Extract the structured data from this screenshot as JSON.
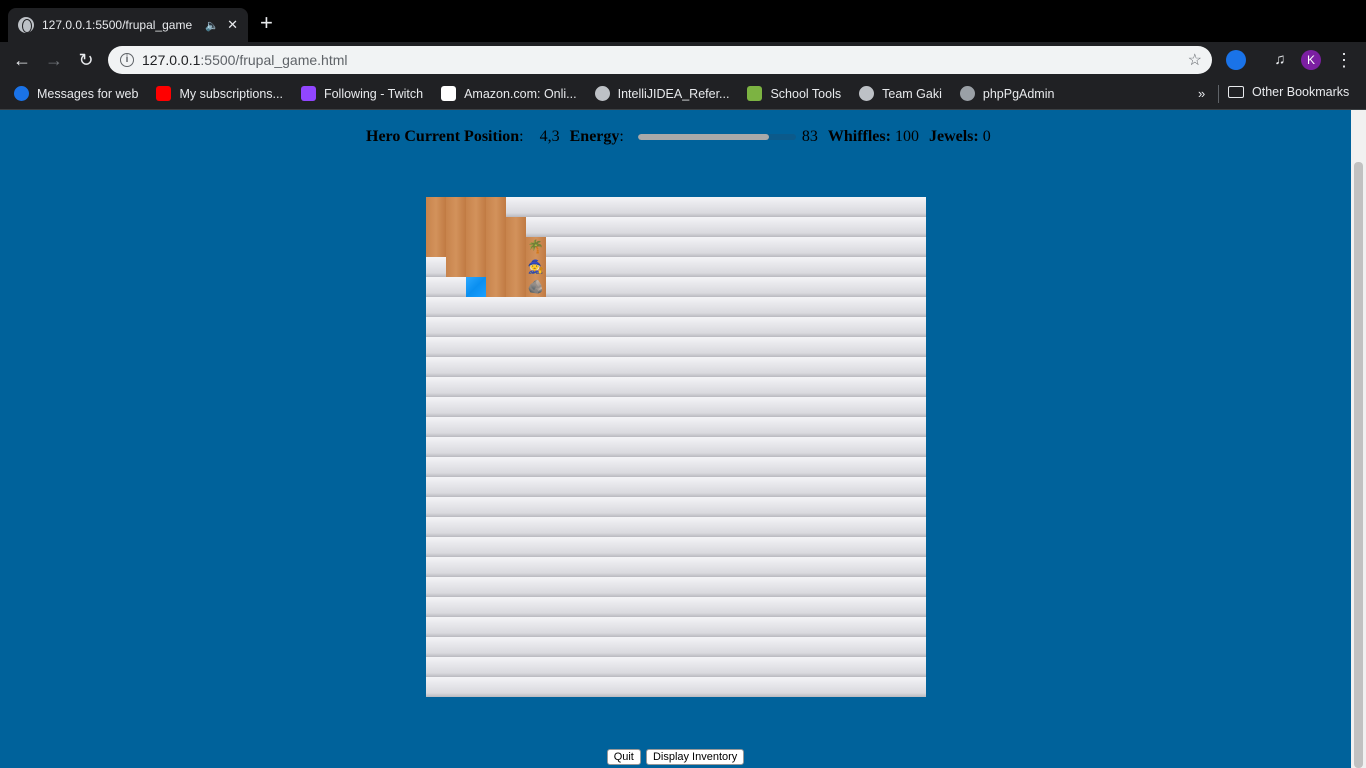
{
  "browser": {
    "tab_title": "127.0.0.1:5500/frupal_game",
    "new_tab_label": "+",
    "url_host": "127.0.0.1",
    "url_path": ":5500/frupal_game.html",
    "profile_initial": "K",
    "bookmarks": [
      {
        "label": "Messages for web",
        "icon": "messages-icon",
        "color": "#1a73e8"
      },
      {
        "label": "My subscriptions...",
        "icon": "youtube-icon",
        "color": "#ff0000"
      },
      {
        "label": "Following - Twitch",
        "icon": "twitch-icon",
        "color": "#9146ff"
      },
      {
        "label": "Amazon.com: Onli...",
        "icon": "amazon-icon",
        "color": "#ffffff"
      },
      {
        "label": "IntelliJIDEA_Refer...",
        "icon": "globe-icon",
        "color": "#bdc1c6"
      },
      {
        "label": "School Tools",
        "icon": "school-icon",
        "color": "#7cb342"
      },
      {
        "label": "Team Gaki",
        "icon": "globe-icon",
        "color": "#bdc1c6"
      },
      {
        "label": "phpPgAdmin",
        "icon": "elephant-icon",
        "color": "#9aa0a6"
      }
    ],
    "more_label": "»",
    "other_bookmarks": "Other Bookmarks"
  },
  "game": {
    "position_label": "Hero Current Position",
    "position_value": "4,3",
    "energy_label": "Energy",
    "energy_value": "83",
    "energy_fraction": 0.83,
    "whiffles_label": "Whiffles:",
    "whiffles_value": "100",
    "jewels_label": "Jewels:",
    "jewels_value": "0",
    "map_size": 25,
    "map_visible": [
      "MMMMF",
      "MMMMMF",
      "MMMMMT",
      "FMMMMH",
      "FFWMMR"
    ],
    "tile_colors": {
      "fog": "#e3e3e7",
      "meadow": "#c98750",
      "water": "#0a8ff0"
    },
    "objects": {
      "T": "tree-icon",
      "H": "hero-icon",
      "R": "boulder-icon"
    }
  },
  "actions": {
    "quit_label": "Quit",
    "inventory_label": "Display Inventory"
  },
  "theme": {
    "page_background": "#00629b"
  }
}
